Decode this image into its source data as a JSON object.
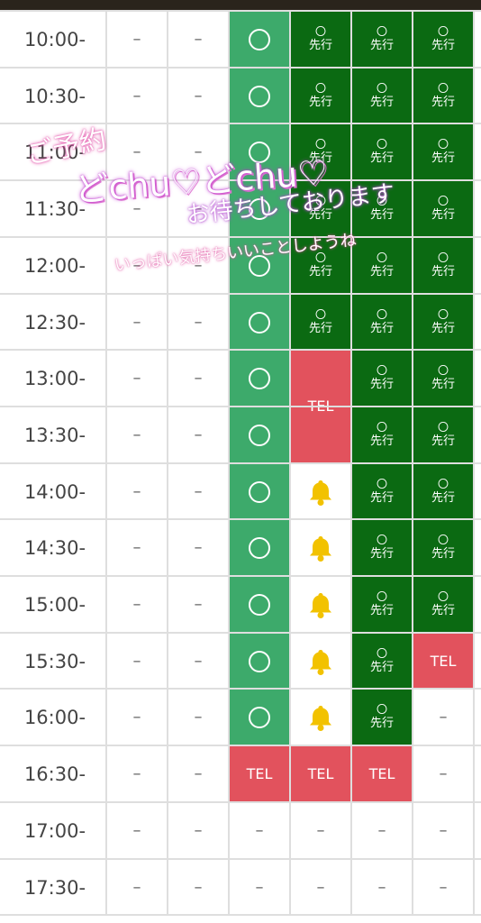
{
  "colors": {
    "available": "#3daa6b",
    "advance": "#0b6a12",
    "tel": "#e2525d",
    "bell": "#f2c200"
  },
  "labels": {
    "available_mark": "〇",
    "advance_mark": "〇",
    "advance_text": "先行",
    "tel_text": "TEL",
    "dash": "–"
  },
  "columns": [
    "time",
    "c1",
    "c2",
    "c3",
    "c4",
    "c5",
    "c6",
    "c7"
  ],
  "rows": [
    {
      "time": "10:00-",
      "cells": [
        "dash",
        "dash",
        "ok",
        "adv",
        "adv",
        "adv"
      ]
    },
    {
      "time": "10:30-",
      "cells": [
        "dash",
        "dash",
        "ok",
        "adv",
        "adv",
        "adv"
      ]
    },
    {
      "time": "11:00-",
      "cells": [
        "dash",
        "dash",
        "ok",
        "adv",
        "adv",
        "adv"
      ]
    },
    {
      "time": "11:30-",
      "cells": [
        "dash",
        "dash",
        "ok",
        "adv",
        "adv",
        "adv"
      ]
    },
    {
      "time": "12:00-",
      "cells": [
        "dash",
        "dash",
        "ok",
        "adv",
        "adv",
        "adv"
      ]
    },
    {
      "time": "12:30-",
      "cells": [
        "dash",
        "dash",
        "ok",
        "adv",
        "adv",
        "adv"
      ]
    },
    {
      "time": "13:00-",
      "cells": [
        "dash",
        "dash",
        "ok",
        "telspan",
        "adv",
        "adv"
      ]
    },
    {
      "time": "13:30-",
      "cells": [
        "dash",
        "dash",
        "ok",
        "skip",
        "adv",
        "adv"
      ]
    },
    {
      "time": "14:00-",
      "cells": [
        "dash",
        "dash",
        "ok",
        "bell",
        "adv",
        "adv"
      ]
    },
    {
      "time": "14:30-",
      "cells": [
        "dash",
        "dash",
        "ok",
        "bell",
        "adv",
        "adv"
      ]
    },
    {
      "time": "15:00-",
      "cells": [
        "dash",
        "dash",
        "ok",
        "bell",
        "adv",
        "adv"
      ]
    },
    {
      "time": "15:30-",
      "cells": [
        "dash",
        "dash",
        "ok",
        "bell",
        "adv",
        "tel"
      ]
    },
    {
      "time": "16:00-",
      "cells": [
        "dash",
        "dash",
        "ok",
        "bell",
        "adv",
        "dash"
      ]
    },
    {
      "time": "16:30-",
      "cells": [
        "dash",
        "dash",
        "tel",
        "tel",
        "tel",
        "dash"
      ]
    },
    {
      "time": "17:00-",
      "cells": [
        "dash",
        "dash",
        "dash",
        "dash",
        "dash",
        "dash"
      ]
    },
    {
      "time": "17:30-",
      "cells": [
        "dash",
        "dash",
        "dash",
        "dash",
        "dash",
        "dash"
      ]
    }
  ],
  "overlay": {
    "line1": "ご予約",
    "line2": "どchu♡どchu♡",
    "line3": "お待ちしております",
    "line4": "いっぱい気持ちいいことしようね"
  }
}
